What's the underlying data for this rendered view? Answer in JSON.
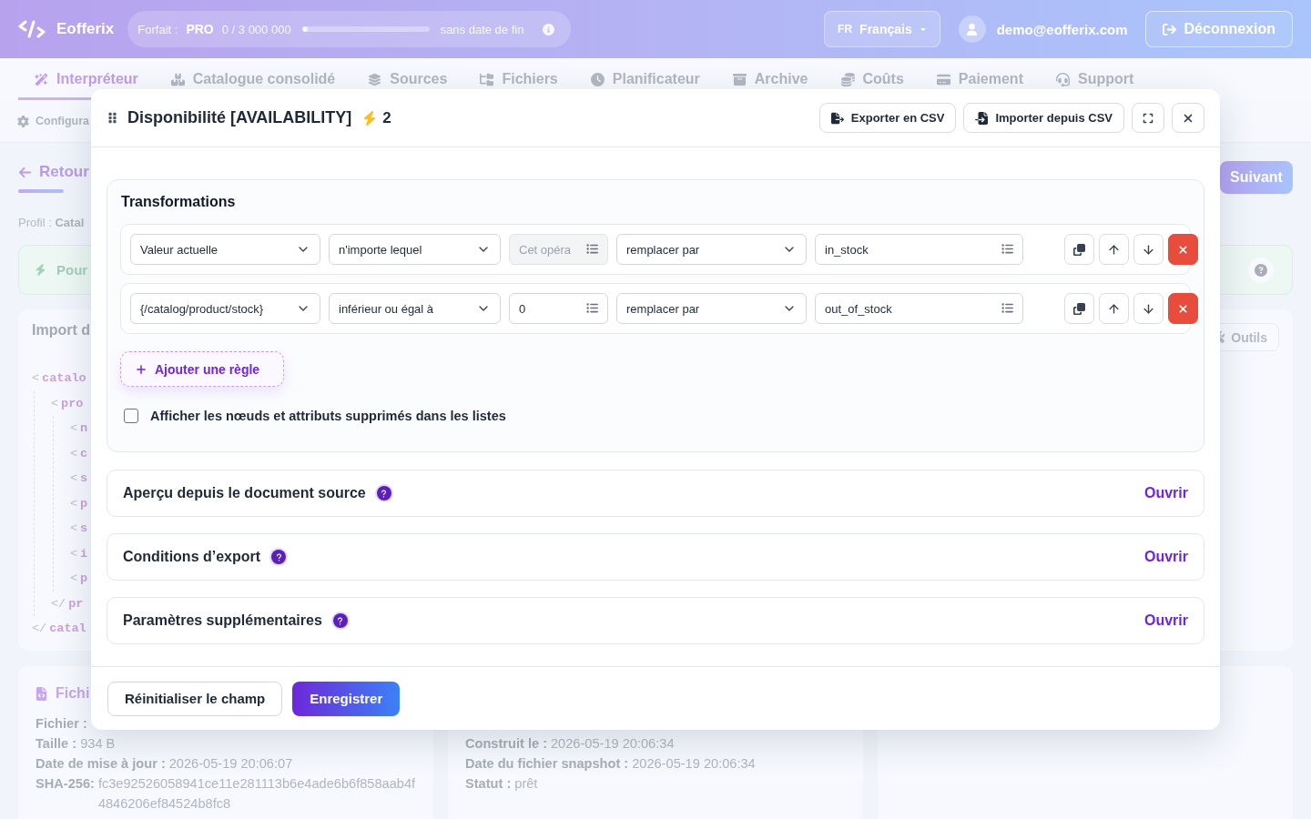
{
  "header": {
    "logo": "Eofferix",
    "plan": {
      "label": "Forfait :",
      "tier": "PRO",
      "usage": "0 / 3 000 000",
      "level": 0,
      "expiry": "sans date de fin"
    },
    "language": {
      "code": "FR",
      "label": "Français"
    },
    "user": "demo@eofferix.com",
    "logout": "Déconnexion"
  },
  "nav": [
    {
      "label": "Interpréteur",
      "selected": true
    },
    {
      "label": "Catalogue consolidé",
      "selected": false
    },
    {
      "label": "Sources",
      "selected": false
    },
    {
      "label": "Fichiers",
      "selected": false
    },
    {
      "label": "Planificateur",
      "selected": false
    },
    {
      "label": "Archive",
      "selected": false
    },
    {
      "label": "Coûts",
      "selected": false
    },
    {
      "label": "Paiement",
      "selected": false
    },
    {
      "label": "Support",
      "selected": false
    }
  ],
  "subnav": {
    "label": "Configura"
  },
  "back": "Retour",
  "next": "Suivant",
  "profile": {
    "label": "Profil :",
    "value": "Catal"
  },
  "alert": {
    "text": "Pour"
  },
  "import_card": {
    "title": "Import d",
    "tools": "Outils",
    "tree": [
      {
        "bracket": "<",
        "name": "catalo",
        "children": [
          {
            "bracket": "<",
            "name": "pro",
            "children": [
              {
                "bracket": "<",
                "name": "n"
              },
              {
                "bracket": "<",
                "name": "c"
              },
              {
                "bracket": "<",
                "name": "s"
              },
              {
                "bracket": "<",
                "name": "p"
              },
              {
                "bracket": "<",
                "name": "s"
              },
              {
                "bracket": "<",
                "name": "i"
              },
              {
                "bracket": "<",
                "name": "p"
              }
            ],
            "close_bracket": "</",
            "close_name": "pr"
          }
        ],
        "close_bracket": "</",
        "close_name": "catal"
      }
    ]
  },
  "file_card": {
    "title": "Fichi",
    "lines": [
      {
        "label": "Fichier :"
      },
      {
        "label": "Taille :",
        "value": "934 B"
      },
      {
        "label": "Date de mise à jour :",
        "value": "2026-05-19 20:06:07"
      },
      {
        "label": "SHA-256:",
        "value": "fc3e92526058941ce11e281113b6e4ade6b6f858aab4f4846206ef84524b8fc8"
      }
    ]
  },
  "snapshot_card": {
    "lines": [
      {
        "label": "Construit le :",
        "value": "2026-05-19 20:06:34"
      },
      {
        "label": "Date du fichier snapshot :",
        "value": "2026-05-19 20:06:34"
      },
      {
        "label": "Statut :",
        "value": "prêt"
      }
    ]
  },
  "modal": {
    "title": "Disponibilité [AVAILABILITY]",
    "count": "2",
    "actions": [
      {
        "label": "Exporter en CSV"
      },
      {
        "label": "Importer depuis CSV"
      }
    ],
    "transformations": {
      "title": "Transformations",
      "rules": [
        {
          "source": "Valeur actuelle",
          "operator": "n'importe lequel",
          "operand": {
            "placeholder": "Cet opéra",
            "disabled": true
          },
          "action": "remplacer par",
          "value": "in_stock"
        },
        {
          "source": "{/catalog/product/stock}",
          "operator": "inférieur ou égal à",
          "operand": {
            "value": "0",
            "disabled": false
          },
          "action": "remplacer par",
          "value": "out_of_stock"
        }
      ],
      "add_rule": "Ajouter une règle",
      "show_deleted": {
        "label": "Afficher les nœuds et attributs supprimés dans les listes",
        "checked": false
      }
    },
    "sections": [
      {
        "title": "Aperçu depuis le document source",
        "action": "Ouvrir"
      },
      {
        "title": "Conditions d’export",
        "action": "Ouvrir"
      },
      {
        "title": "Paramètres supplémentaires",
        "action": "Ouvrir"
      }
    ],
    "footer": {
      "reset": "Réinitialiser le champ",
      "save": "Enregistrer"
    }
  }
}
